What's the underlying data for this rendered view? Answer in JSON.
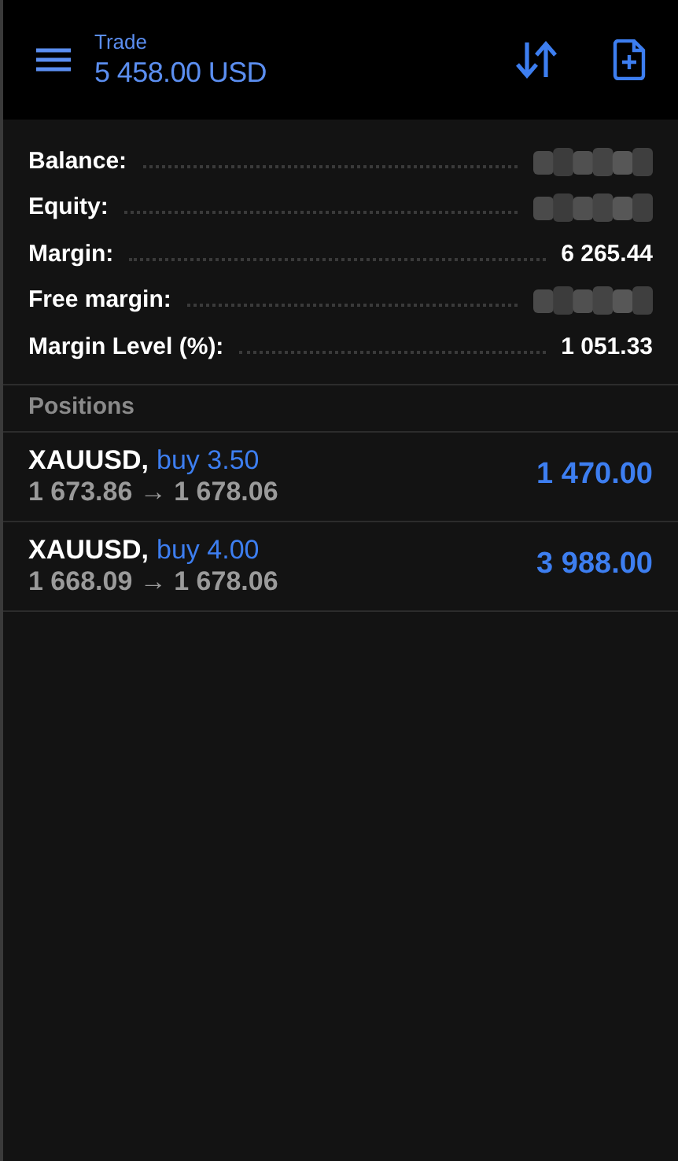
{
  "header": {
    "title": "Trade",
    "balance": "5 458.00 USD"
  },
  "summary": [
    {
      "label": "Balance:",
      "kind": "redacted"
    },
    {
      "label": "Equity:",
      "kind": "redacted"
    },
    {
      "label": "Margin:",
      "kind": "value",
      "value": "6 265.44"
    },
    {
      "label": "Free margin:",
      "kind": "redacted"
    },
    {
      "label": "Margin Level (%):",
      "kind": "value",
      "value": "1 051.33"
    }
  ],
  "positions": {
    "title": "Positions",
    "items": [
      {
        "symbol": "XAUUSD,",
        "order": "buy 3.50",
        "prices": "1 673.86 → 1 678.06",
        "profit": "1 470.00"
      },
      {
        "symbol": "XAUUSD,",
        "order": "buy 4.00",
        "prices": "1 668.09 → 1 678.06",
        "profit": "3 988.00"
      }
    ]
  }
}
